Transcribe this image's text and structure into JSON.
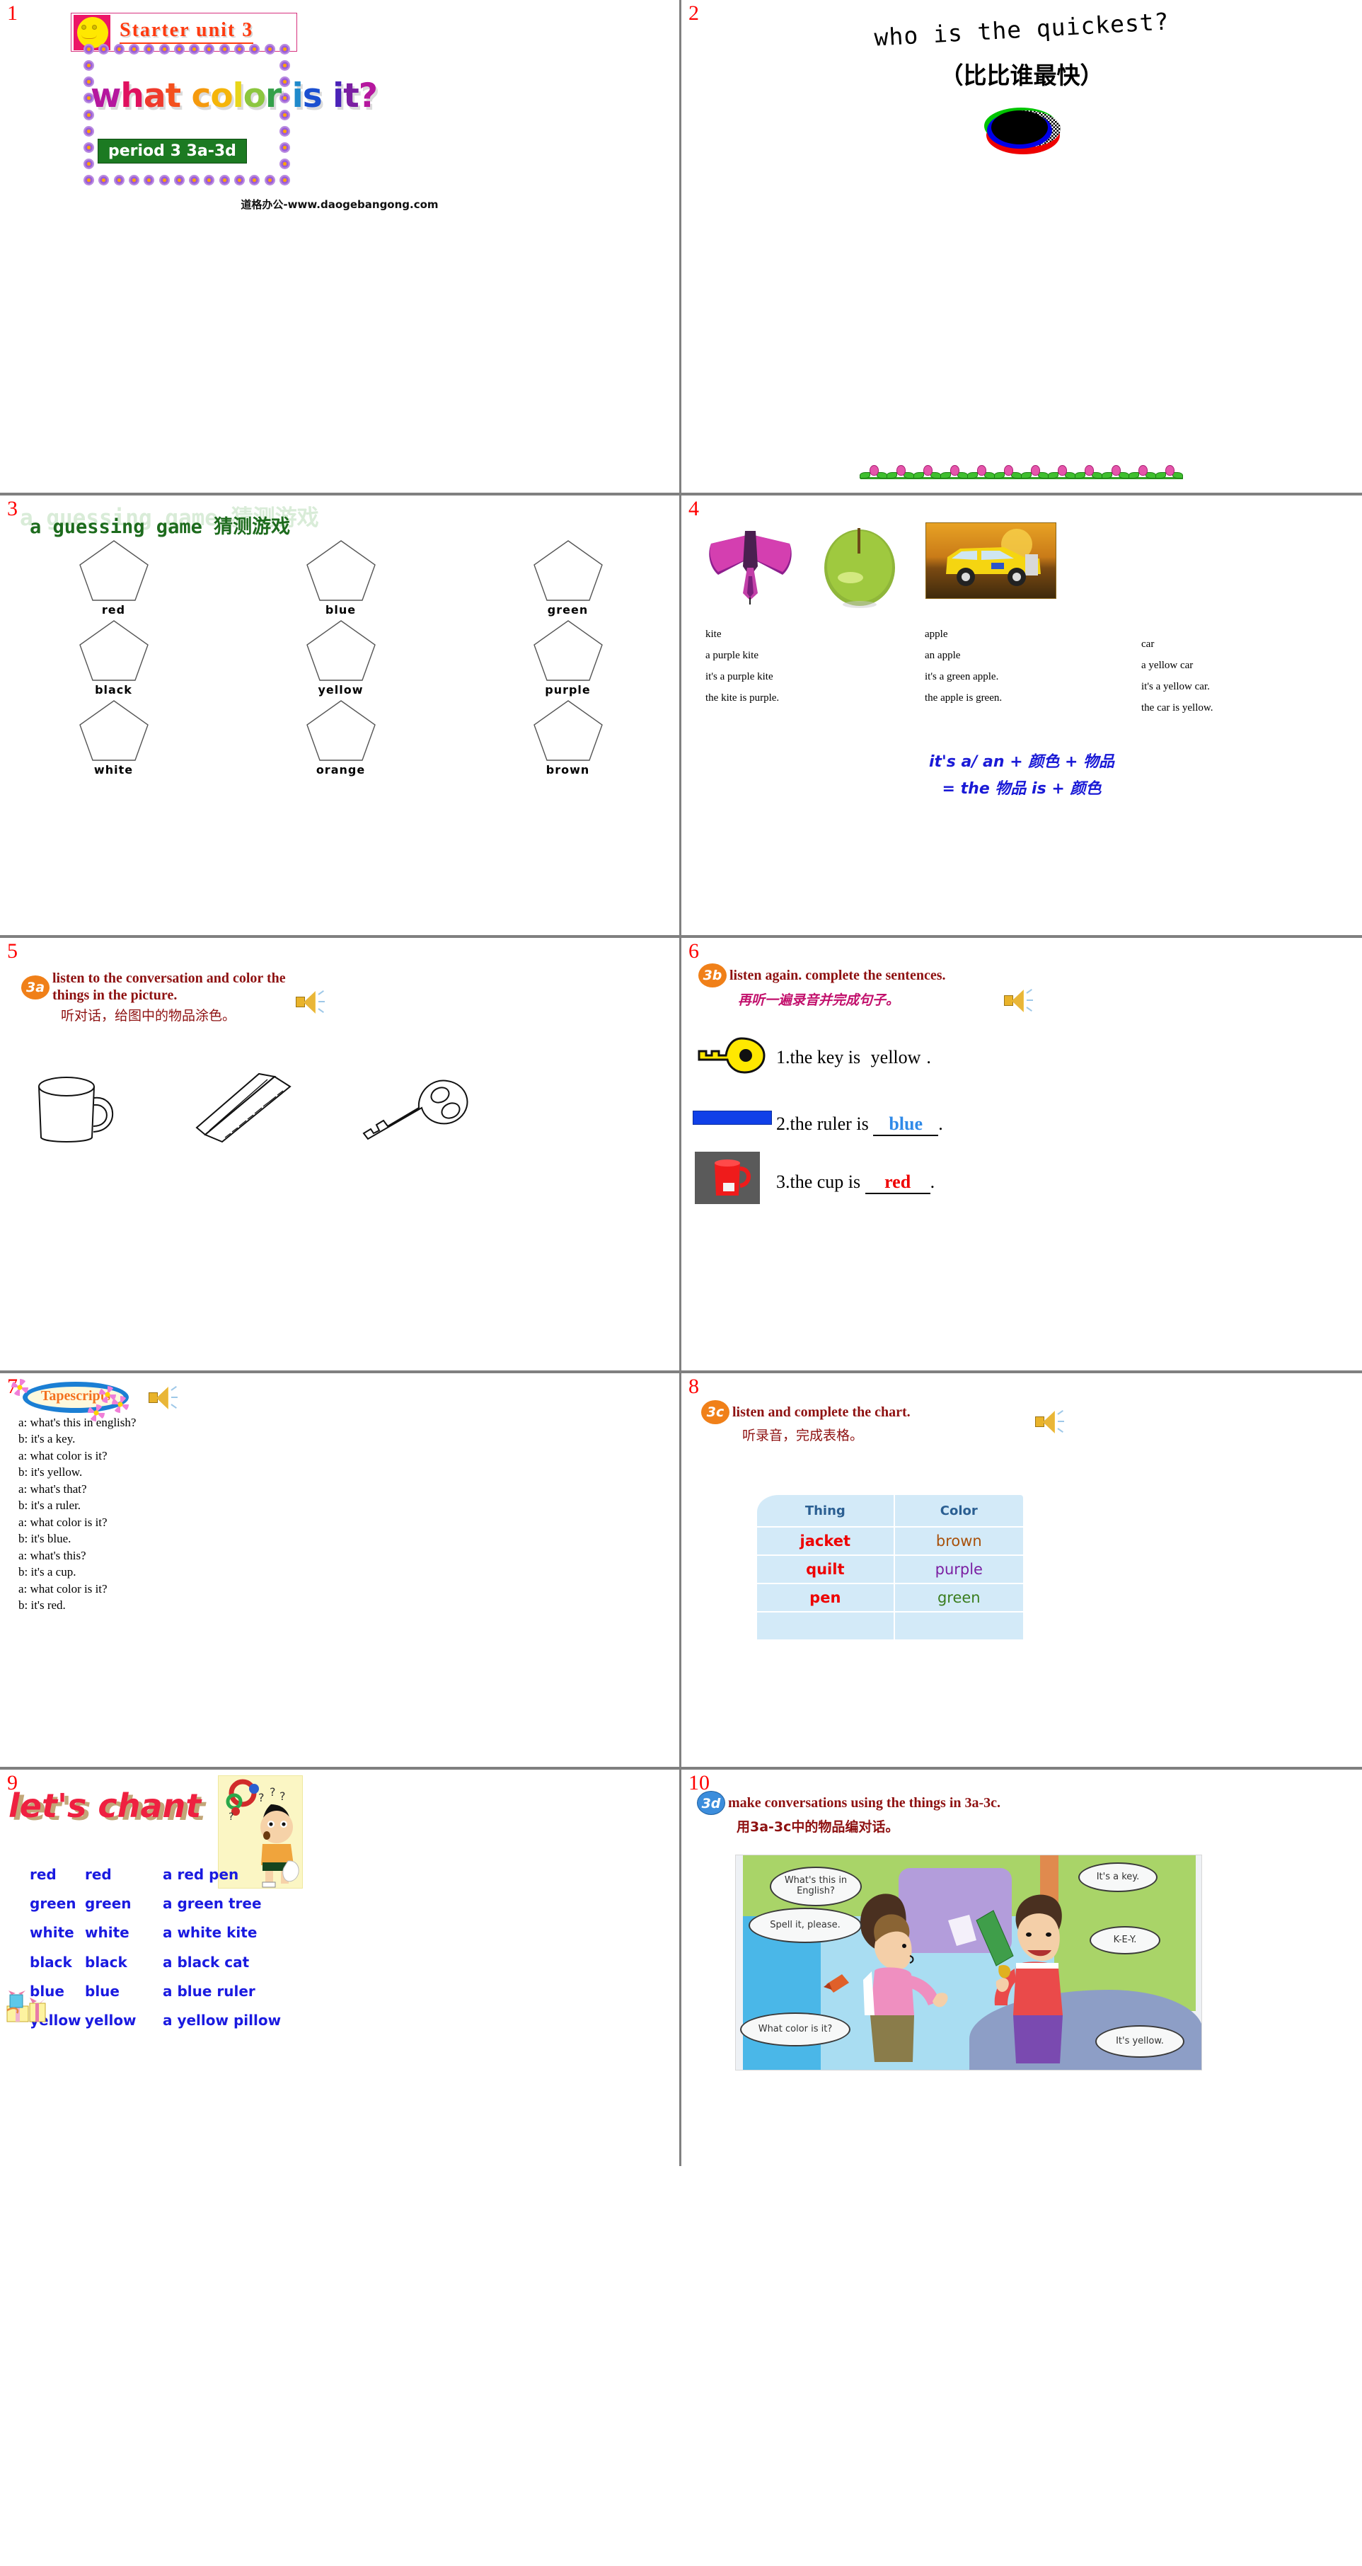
{
  "slide1": {
    "number": "1",
    "starter_title": "Starter unit 3",
    "main_title": "what color is it?",
    "period": "period 3 3a-3d",
    "footer": "道格办公-www.daogebangong.com"
  },
  "slide2": {
    "number": "2",
    "question_en": "who is the quickest?",
    "question_cn": "（比比谁最快）"
  },
  "slide3": {
    "number": "3",
    "title_en": "a guessing game",
    "title_cn": "猜测游戏",
    "colors": [
      "red",
      "blue",
      "green",
      "black",
      "yellow",
      "purple",
      "white",
      "orange",
      "brown"
    ]
  },
  "slide4": {
    "number": "4",
    "columns": [
      {
        "noun": "kite",
        "phrase": "a purple kite",
        "sentence1": "it's a purple kite",
        "sentence2": "the kite is purple."
      },
      {
        "noun": "apple",
        "phrase": "an apple",
        "sentence1": "it's a green apple.",
        "sentence2": "the apple is green."
      },
      {
        "noun": "car",
        "phrase": "a yellow car",
        "sentence1": "it's a yellow car.",
        "sentence2": "the car is yellow."
      }
    ],
    "formula1": "it's a/ an + 颜色 + 物品",
    "formula2": "= the 物品 is + 颜色"
  },
  "slide5": {
    "number": "5",
    "badge": "3a",
    "instruction_en": "listen to the conversation and color the things in the picture.",
    "instruction_cn": "听对话，给图中的物品涂色。",
    "objects": [
      "cup",
      "ruler",
      "key"
    ]
  },
  "slide6": {
    "number": "6",
    "badge": "3b",
    "instruction_en": "listen again. complete the sentences.",
    "instruction_cn": "再听一遍录音并完成句子。",
    "items": [
      {
        "prefix": "1.the key is",
        "answer": "yellow",
        "suffix": ".",
        "answer_color": "#000000"
      },
      {
        "prefix": "2.the ruler is",
        "answer": "blue",
        "suffix": ".",
        "answer_color": "#2f8ae8"
      },
      {
        "prefix": "3.the cup is",
        "answer": "red",
        "suffix": ".",
        "answer_color": "#ee0000"
      }
    ]
  },
  "slide7": {
    "number": "7",
    "title": "Tapescripts",
    "lines": [
      "a: what's this in english?",
      "b: it's a key.",
      "a: what color is it?",
      "b: it's yellow.",
      "a: what's that?",
      "b: it's a ruler.",
      "a: what color is it?",
      "b: it's blue.",
      "a: what's this?",
      "b: it's a cup.",
      "a: what color is it?",
      "b: it's red."
    ]
  },
  "slide8": {
    "number": "8",
    "badge": "3c",
    "instruction_en": "listen and complete the chart.",
    "instruction_cn": "听录音，完成表格。",
    "chart_data": {
      "type": "table",
      "title": "listen and complete the chart.",
      "headers": [
        "Thing",
        "Color"
      ],
      "rows": [
        {
          "thing": "jacket",
          "color": "brown",
          "color_hex": "#a8510b"
        },
        {
          "thing": "quilt",
          "color": "purple",
          "color_hex": "#7b1fa2"
        },
        {
          "thing": "pen",
          "color": "green",
          "color_hex": "#3a7d1e"
        },
        {
          "thing": "",
          "color": "",
          "color_hex": "#000000"
        }
      ],
      "thing_color_hex": "#ee0000",
      "header_color_hex": "#2b5f92",
      "cell_bg_hex": "#d3eaf8"
    }
  },
  "slide9": {
    "number": "9",
    "title": "let's chant",
    "lines": [
      {
        "word": "red",
        "repeat": "red",
        "phrase": "a red pen"
      },
      {
        "word": "green",
        "repeat": "green",
        "phrase": "a green tree"
      },
      {
        "word": "white",
        "repeat": "white",
        "phrase": "a white kite"
      },
      {
        "word": "black",
        "repeat": "black",
        "phrase": "a black cat"
      },
      {
        "word": "blue",
        "repeat": "blue",
        "phrase": "a blue ruler"
      },
      {
        "word": "yellow",
        "repeat": "yellow",
        "phrase": "a yellow pillow"
      }
    ]
  },
  "slide10": {
    "number": "10",
    "badge": "3d",
    "instruction_en": "make conversations using the things in 3a-3c.",
    "instruction_cn": "用3a-3c中的物品编对话。",
    "bubbles": [
      "What's this in English?",
      "It's a key.",
      "Spell it, please.",
      "K-E-Y.",
      "What color is it?",
      "It's yellow."
    ]
  },
  "colors": {
    "slide_number": "#ff0000",
    "heading_dark_red": "#8e1111",
    "badge_orange": "#f08019",
    "badge_blue": "#3c8ddc",
    "formula_blue": "#1a1ad6",
    "chant_blue": "#1a1ae0",
    "chant_title_pink": "#ef2040",
    "green_title": "#1d6b1d",
    "period_green_bg": "#1c7a22"
  }
}
